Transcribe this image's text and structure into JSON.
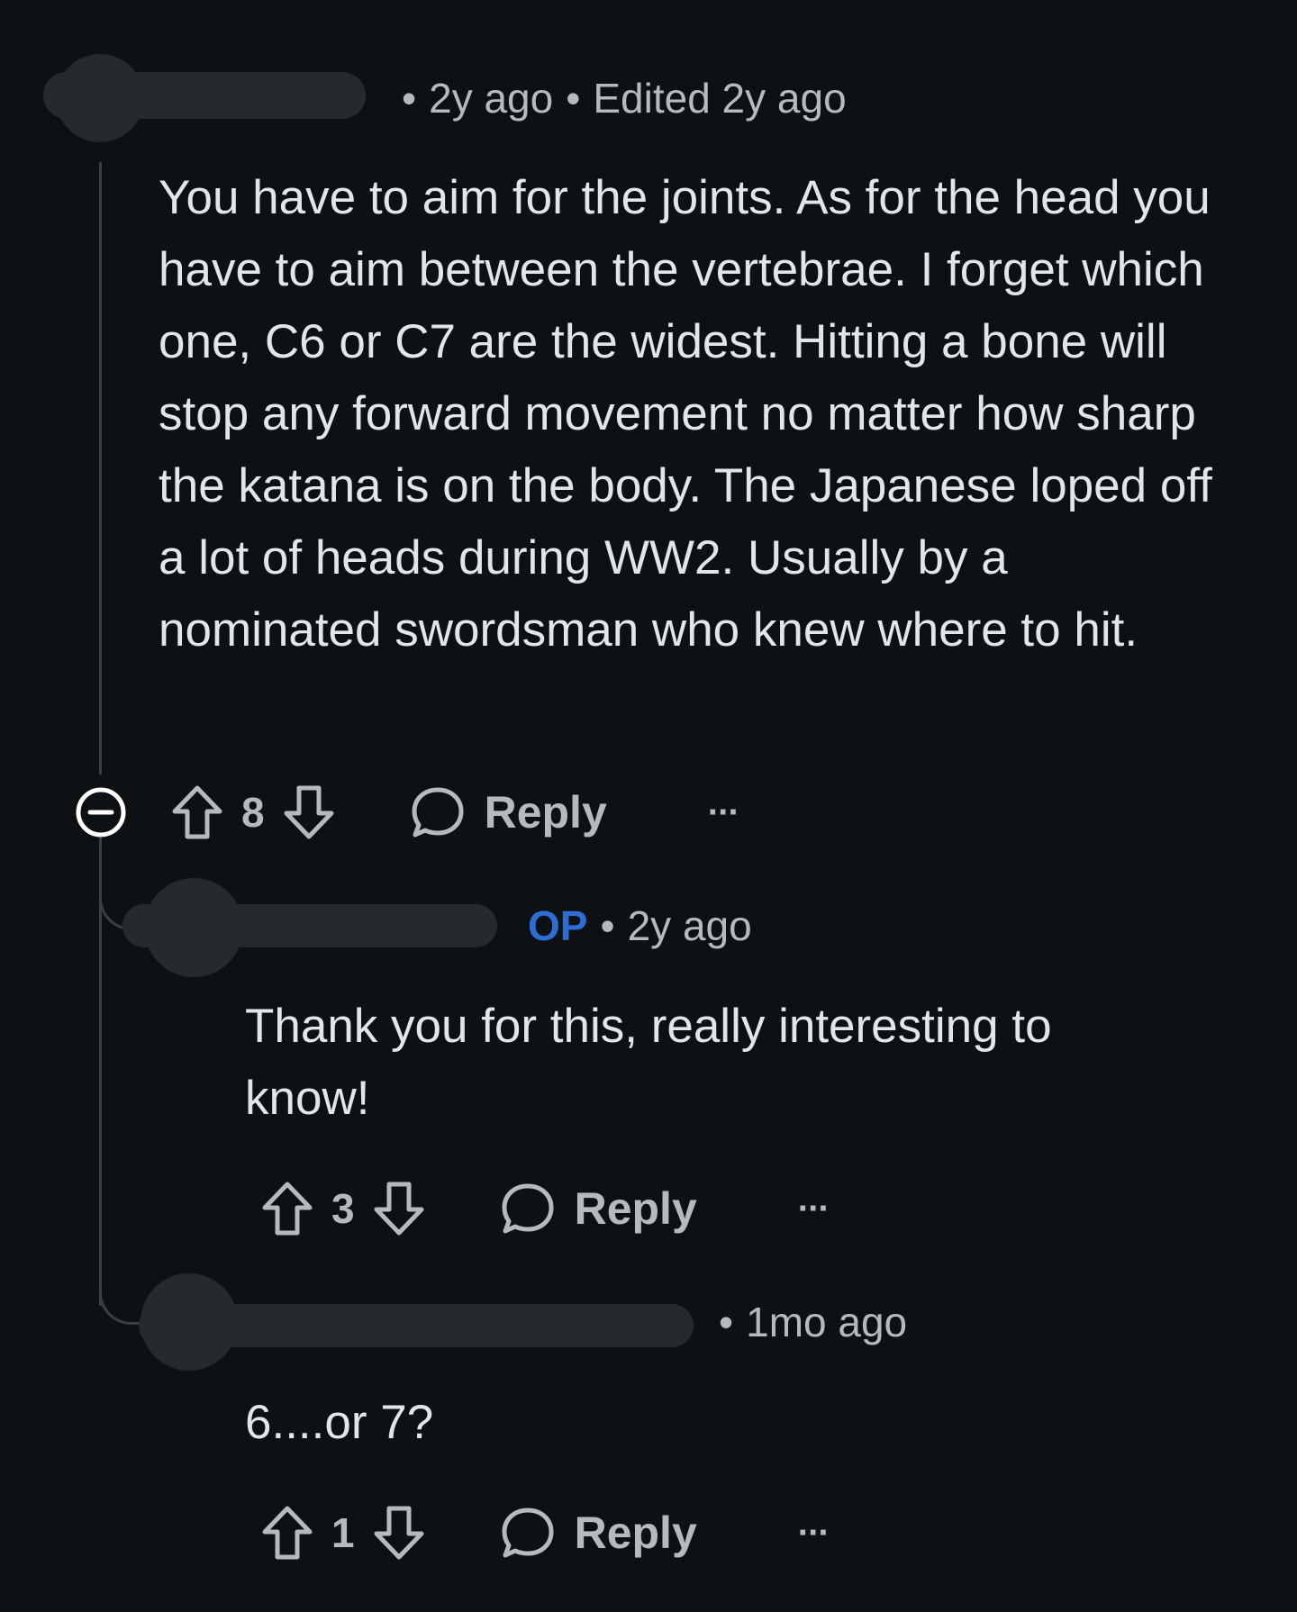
{
  "comments": [
    {
      "meta": {
        "age": "2y ago",
        "edited": "Edited 2y ago"
      },
      "body": "You have to aim for the joints. As for the head you have to aim between the vertebrae. I forget which one, C6 or C7 are the widest. Hitting a bone will stop any forward movement no matter how sharp the katana is on the body. The Japanese loped off a lot of heads during WW2. Usually by a nominated swordsman who knew where to hit.",
      "score": "8",
      "reply_label": "Reply",
      "more_label": "···"
    },
    {
      "meta": {
        "badge": "OP",
        "age": "2y ago"
      },
      "body": "Thank you for this, really interesting to know!",
      "score": "3",
      "reply_label": "Reply",
      "more_label": "···"
    },
    {
      "meta": {
        "age": "1mo ago"
      },
      "body": "6....or 7?",
      "score": "1",
      "reply_label": "Reply",
      "more_label": "···"
    }
  ],
  "icons": {
    "collapse": "collapse-thread-icon",
    "upvote": "upvote-arrow-icon",
    "downvote": "downvote-arrow-icon",
    "reply": "speech-bubble-icon"
  },
  "colors": {
    "background": "#0e1113",
    "text": "#e3e6e8",
    "meta": "#b4babe",
    "op_badge": "#2c6dd6",
    "thread_line": "#3a3f44"
  }
}
